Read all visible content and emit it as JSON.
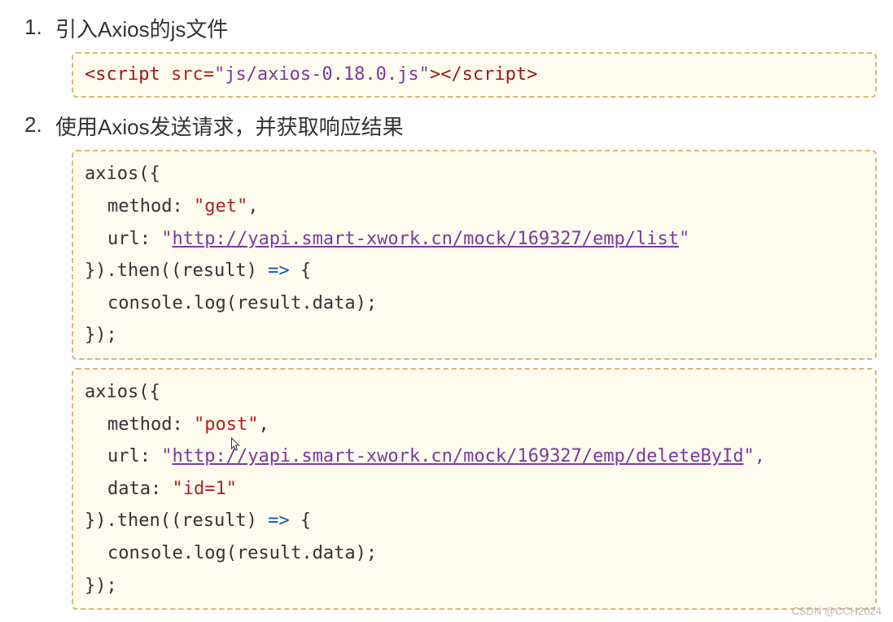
{
  "item1": {
    "num": "1.",
    "title": "引入Axios的js文件"
  },
  "script_tag": {
    "open": "<script ",
    "attr": "src=",
    "val": "\"js/axios-0.18.0.js\"",
    "close": "></script>"
  },
  "item2": {
    "num": "2.",
    "title": "使用Axios发送请求，并获取响应结果"
  },
  "code_get": {
    "l1": "axios({",
    "l2a": "method: ",
    "l2b": "\"get\"",
    "l2c": ",",
    "l3a": "url: ",
    "l3b": "\"",
    "l3url": "http://yapi.smart-xwork.cn/mock/169327/emp/list",
    "l3c": "\"",
    "l4a": "}).then((result) ",
    "l4b": "=>",
    "l4c": " {",
    "l5": "console.log(result.data);",
    "l6": "});"
  },
  "code_post": {
    "l1": "axios({",
    "l2a": "method: ",
    "l2b": "\"post\"",
    "l2c": ",",
    "l3a": "url: ",
    "l3b": "\"",
    "l3url": "http://yapi.smart-xwork.cn/mock/169327/emp/deleteById",
    "l3c": "\",",
    "l4a": "data: ",
    "l4b": "\"id=1\"",
    "l5a": "}).then((result) ",
    "l5b": "=>",
    "l5c": " {",
    "l6": "console.log(result.data);",
    "l7": "});"
  },
  "watermark": "CSDN @CCH2024"
}
